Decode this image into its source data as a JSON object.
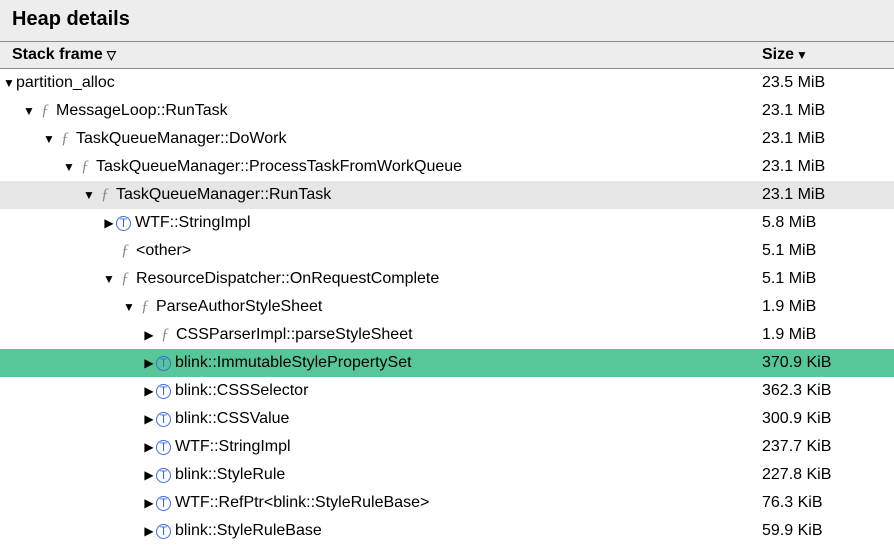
{
  "title": "Heap details",
  "columns": {
    "stack": "Stack frame",
    "size": "Size"
  },
  "indent_unit": 20,
  "base_indent": 2,
  "rows": [
    {
      "indent": 0,
      "arrow": "down",
      "icon": null,
      "label": "partition_alloc",
      "size": "23.5 MiB",
      "hl": null
    },
    {
      "indent": 1,
      "arrow": "down",
      "icon": "fn",
      "label": "MessageLoop::RunTask",
      "size": "23.1 MiB",
      "hl": null
    },
    {
      "indent": 2,
      "arrow": "down",
      "icon": "fn",
      "label": "TaskQueueManager::DoWork",
      "size": "23.1 MiB",
      "hl": null
    },
    {
      "indent": 3,
      "arrow": "down",
      "icon": "fn",
      "label": "TaskQueueManager::ProcessTaskFromWorkQueue",
      "size": "23.1 MiB",
      "hl": null
    },
    {
      "indent": 4,
      "arrow": "down",
      "icon": "fn",
      "label": "TaskQueueManager::RunTask",
      "size": "23.1 MiB",
      "hl": "grey"
    },
    {
      "indent": 5,
      "arrow": "right",
      "icon": "type",
      "label": "WTF::StringImpl",
      "size": "5.8 MiB",
      "hl": null
    },
    {
      "indent": 5,
      "arrow": "blank",
      "icon": "fn",
      "label": "<other>",
      "size": "5.1 MiB",
      "hl": null
    },
    {
      "indent": 5,
      "arrow": "down",
      "icon": "fn",
      "label": "ResourceDispatcher::OnRequestComplete",
      "size": "5.1 MiB",
      "hl": null
    },
    {
      "indent": 6,
      "arrow": "down",
      "icon": "fn",
      "label": "ParseAuthorStyleSheet",
      "size": "1.9 MiB",
      "hl": null
    },
    {
      "indent": 7,
      "arrow": "right",
      "icon": "fn",
      "label": "CSSParserImpl::parseStyleSheet",
      "size": "1.9 MiB",
      "hl": null
    },
    {
      "indent": 7,
      "arrow": "right",
      "icon": "type",
      "label": "blink::ImmutableStylePropertySet",
      "size": "370.9 KiB",
      "hl": "green"
    },
    {
      "indent": 7,
      "arrow": "right",
      "icon": "type",
      "label": "blink::CSSSelector",
      "size": "362.3 KiB",
      "hl": null
    },
    {
      "indent": 7,
      "arrow": "right",
      "icon": "type",
      "label": "blink::CSSValue",
      "size": "300.9 KiB",
      "hl": null
    },
    {
      "indent": 7,
      "arrow": "right",
      "icon": "type",
      "label": "WTF::StringImpl",
      "size": "237.7 KiB",
      "hl": null
    },
    {
      "indent": 7,
      "arrow": "right",
      "icon": "type",
      "label": "blink::StyleRule",
      "size": "227.8 KiB",
      "hl": null
    },
    {
      "indent": 7,
      "arrow": "right",
      "icon": "type",
      "label": "WTF::RefPtr<blink::StyleRuleBase>",
      "size": "76.3 KiB",
      "hl": null
    },
    {
      "indent": 7,
      "arrow": "right",
      "icon": "type",
      "label": "blink::StyleRuleBase",
      "size": "59.9 KiB",
      "hl": null
    }
  ]
}
